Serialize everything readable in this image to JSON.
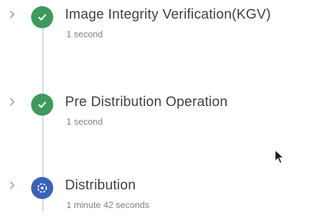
{
  "steps": [
    {
      "title": "Image Integrity Verification(KGV)",
      "duration": "1 second",
      "status": "completed",
      "status_icon": "check-circle-icon",
      "expand_icon": "chevron-right-icon"
    },
    {
      "title": "Pre Distribution Operation",
      "duration": "1 second",
      "status": "completed",
      "status_icon": "check-circle-icon",
      "expand_icon": "chevron-right-icon"
    },
    {
      "title": "Distribution",
      "duration": "1 minute 42 seconds",
      "status": "in-progress",
      "status_icon": "in-progress-icon",
      "expand_icon": "chevron-right-icon"
    }
  ],
  "colors": {
    "completed": "#3b9a5c",
    "in_progress": "#3a63b8",
    "timeline": "#d7dbe0",
    "title_text": "#3c4148",
    "duration_text": "#7b828a"
  }
}
